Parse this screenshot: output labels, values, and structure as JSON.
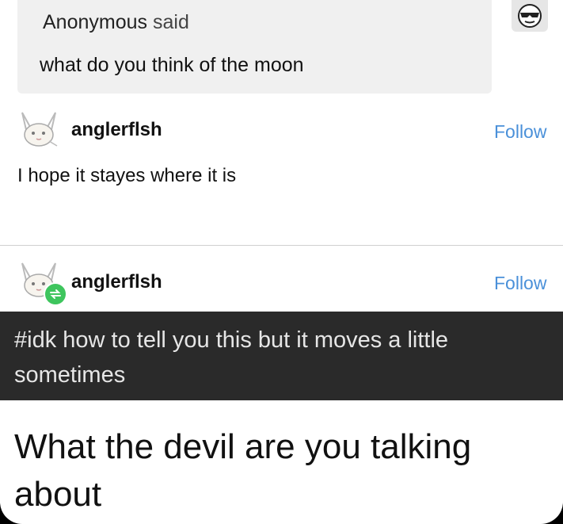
{
  "ask": {
    "author": "Anonymous",
    "said": "said",
    "question": "what do you think of the moon",
    "avatar_icon": "sunglasses-face-icon"
  },
  "answer": {
    "username": "anglerflsh",
    "follow_label": "Follow",
    "text": "I hope it stayes where it is",
    "avatar_icon": "rabbit-drawing-icon"
  },
  "reblog": {
    "username": "anglerflsh",
    "follow_label": "Follow",
    "badge_icon": "reblog-icon",
    "badge_color": "#3ec55d",
    "tags": "#idk how to tell you this but it moves a little sometimes"
  },
  "reply": {
    "text": "What the devil are you talking about"
  },
  "colors": {
    "link": "#4a90d9",
    "tag_bar": "#2a2a2a",
    "ask_box": "#f0f0f0"
  }
}
